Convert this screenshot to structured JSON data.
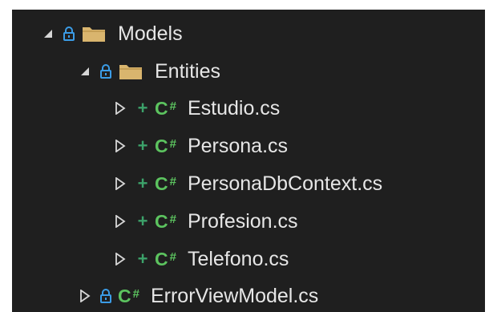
{
  "tree": {
    "models_folder": {
      "label": "Models",
      "icon": "folder-icon",
      "expanded": true,
      "locked": true
    },
    "entities_folder": {
      "label": "Entities",
      "icon": "folder-icon",
      "expanded": true,
      "locked": true
    },
    "files": [
      {
        "label": "Estudio.cs",
        "status": "+",
        "type_badge": "C",
        "type_hash": "#"
      },
      {
        "label": "Persona.cs",
        "status": "+",
        "type_badge": "C",
        "type_hash": "#"
      },
      {
        "label": "PersonaDbContext.cs",
        "status": "+",
        "type_badge": "C",
        "type_hash": "#"
      },
      {
        "label": "Profesion.cs",
        "status": "+",
        "type_badge": "C",
        "type_hash": "#"
      },
      {
        "label": "Telefono.cs",
        "status": "+",
        "type_badge": "C",
        "type_hash": "#"
      }
    ],
    "error_view_model": {
      "label": "ErrorViewModel.cs",
      "type_badge": "C",
      "type_hash": "#",
      "locked": true
    }
  },
  "colors": {
    "background": "#1f1f1f",
    "text": "#e6e6e6",
    "lock": "#3b9ce6",
    "folder": "#d9b56e",
    "csharp": "#5cc35f",
    "added": "#3ca26a"
  }
}
